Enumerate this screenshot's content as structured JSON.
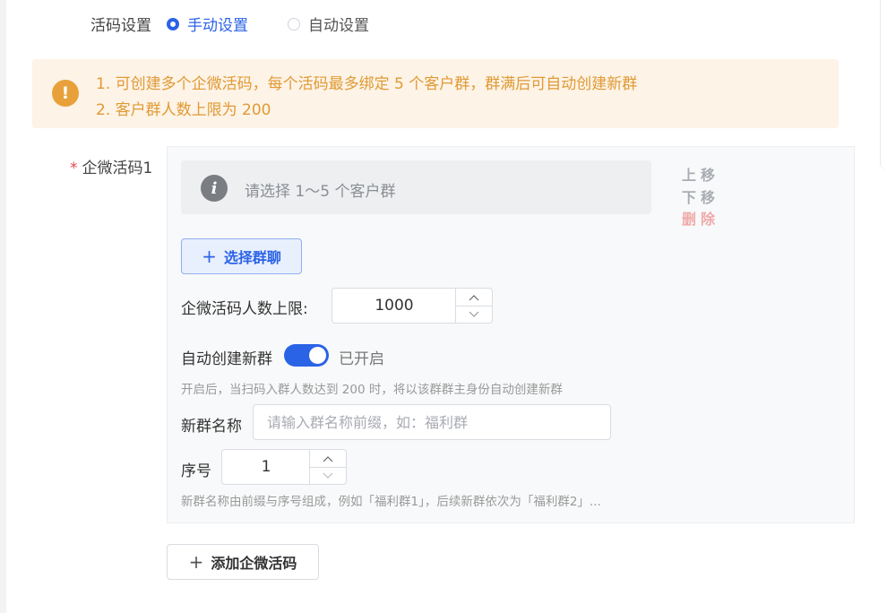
{
  "mode": {
    "label": "活码设置",
    "options": [
      {
        "label": "手动设置",
        "checked": true
      },
      {
        "label": "自动设置",
        "checked": false
      }
    ]
  },
  "tips": {
    "icon": "warning-icon",
    "line1": "1. 可创建多个企微活码，每个活码最多绑定 5 个客户群，群满后可自动创建新群",
    "line2": "2. 客户群人数上限为 200"
  },
  "code_item": {
    "required_mark": "*",
    "label": "企微活码1",
    "select_placeholder": "请选择 1～5 个客户群",
    "info_icon": "i",
    "actions": {
      "up": "上移",
      "down": "下移",
      "delete": "删除"
    },
    "select_button": "选择群聊",
    "limit": {
      "label": "企微活码人数上限:",
      "value": "1000"
    },
    "auto_create": {
      "label": "自动创建新群",
      "enabled": true,
      "status": "已开启",
      "hint": "开启后，当扫码入群人数达到 200 时，将以该群群主身份自动创建新群"
    },
    "new_group_name": {
      "label": "新群名称",
      "placeholder": "请输入群名称前缀，如：福利群",
      "value": ""
    },
    "sequence": {
      "label": "序号",
      "value": "1",
      "hint": "新群名称由前缀与序号组成，例如「福利群1」，后续新群依次为「福利群2」..."
    }
  },
  "add_button": "添加企微活码",
  "colors": {
    "primary": "#2b63e6",
    "warning": "#e8a13a",
    "danger": "#e5484d"
  }
}
